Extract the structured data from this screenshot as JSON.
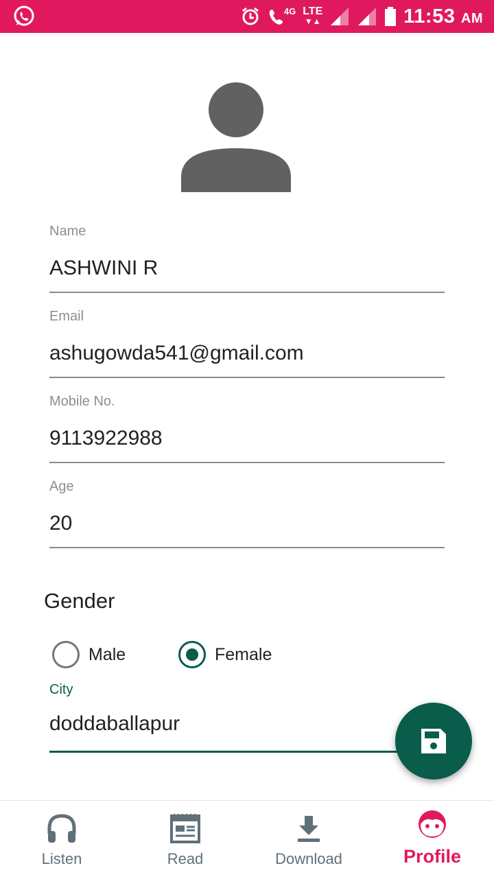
{
  "status_bar": {
    "network_4g": "4G",
    "network_lte": "LTE",
    "time": "11:53",
    "ampm": "AM",
    "color": "#e0195f"
  },
  "profile": {
    "avatar_icon": "person-icon",
    "fields": {
      "name": {
        "label": "Name",
        "value": "ASHWINI R"
      },
      "email": {
        "label": "Email",
        "value": "ashugowda541@gmail.com"
      },
      "mobile": {
        "label": "Mobile No.",
        "value": "9113922988"
      },
      "age": {
        "label": "Age",
        "value": "20"
      },
      "city": {
        "label": "City",
        "value": "doddaballapur"
      }
    },
    "gender": {
      "title": "Gender",
      "options": [
        "Male",
        "Female"
      ],
      "selected": "Female"
    },
    "save_icon": "save-icon"
  },
  "bottom_nav": {
    "items": [
      {
        "label": "Listen",
        "icon": "headphones-icon"
      },
      {
        "label": "Read",
        "icon": "newspaper-icon"
      },
      {
        "label": "Download",
        "icon": "download-icon"
      },
      {
        "label": "Profile",
        "icon": "face-icon"
      }
    ],
    "active": "Profile"
  },
  "colors": {
    "accent": "#e0195f",
    "primary": "#0a5c4b",
    "inactive_nav": "#607078"
  }
}
